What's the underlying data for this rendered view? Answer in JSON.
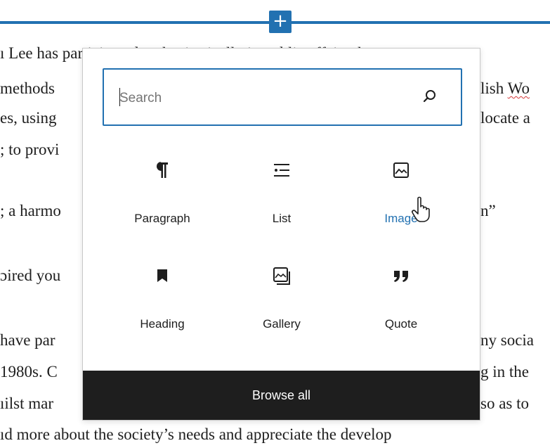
{
  "inserter": {
    "plus_label": "+"
  },
  "editor_text": {
    "line1_left": "ı Lee has participated enthusiastically in public affairs throu",
    "line2_left": "methods",
    "line2_right_plain": "lish ",
    "line2_right_squiggle": "Wo",
    "line3_left": "es, using",
    "line3_right": "locate a",
    "line4_left": "; to provi",
    "line5_left": "; a harmo",
    "line5_right": "n”",
    "line6_left": "ɔired you",
    "line7_left": "have par",
    "line7_right": "ny socia",
    "line8_left": "1980s. C",
    "line8_right": "g in the",
    "line9_left": "ıilst mar",
    "line9_right": "so as to",
    "line10": "ıd more about the society’s needs and appreciate the develop"
  },
  "popover": {
    "search": {
      "placeholder": "Search",
      "value": ""
    },
    "blocks": [
      {
        "label": "Paragraph",
        "icon": "paragraph-icon"
      },
      {
        "label": "List",
        "icon": "list-icon"
      },
      {
        "label": "Image",
        "icon": "image-icon"
      },
      {
        "label": "Heading",
        "icon": "heading-icon"
      },
      {
        "label": "Gallery",
        "icon": "gallery-icon"
      },
      {
        "label": "Quote",
        "icon": "quote-icon"
      }
    ],
    "browse_all_label": "Browse all"
  },
  "colors": {
    "accent": "#2271b1",
    "dark": "#1e1e1e"
  }
}
